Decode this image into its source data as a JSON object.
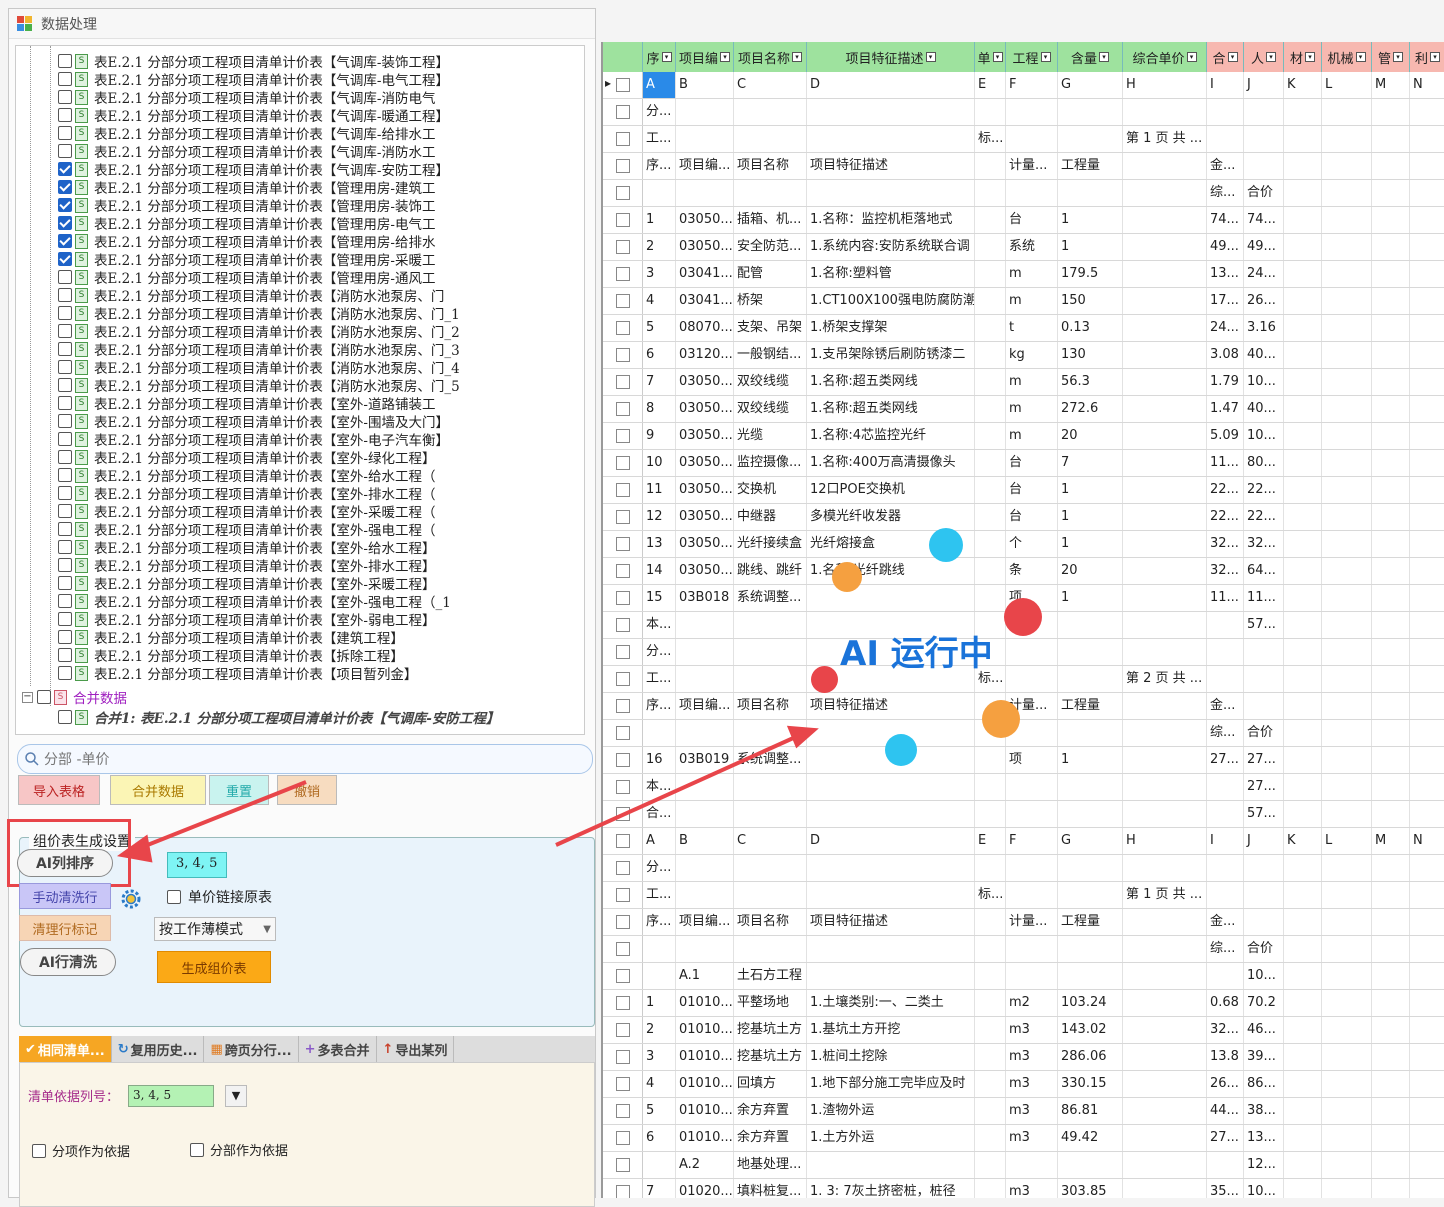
{
  "window": {
    "title": "数据处理"
  },
  "tree": {
    "items": [
      {
        "label": "表E.2.1 分部分项工程项目清单计价表【气调库-装饰工程】",
        "checked": false
      },
      {
        "label": "表E.2.1 分部分项工程项目清单计价表【气调库-电气工程】",
        "checked": false
      },
      {
        "label": "表E.2.1 分部分项工程项目清单计价表【气调库-消防电气",
        "checked": false
      },
      {
        "label": "表E.2.1 分部分项工程项目清单计价表【气调库-暖通工程】",
        "checked": false
      },
      {
        "label": "表E.2.1 分部分项工程项目清单计价表【气调库-给排水工",
        "checked": false
      },
      {
        "label": "表E.2.1 分部分项工程项目清单计价表【气调库-消防水工",
        "checked": false
      },
      {
        "label": "表E.2.1 分部分项工程项目清单计价表【气调库-安防工程】",
        "checked": true
      },
      {
        "label": "表E.2.1 分部分项工程项目清单计价表【管理用房-建筑工",
        "checked": true
      },
      {
        "label": "表E.2.1 分部分项工程项目清单计价表【管理用房-装饰工",
        "checked": true
      },
      {
        "label": "表E.2.1 分部分项工程项目清单计价表【管理用房-电气工",
        "checked": true
      },
      {
        "label": "表E.2.1 分部分项工程项目清单计价表【管理用房-给排水",
        "checked": true
      },
      {
        "label": "表E.2.1 分部分项工程项目清单计价表【管理用房-采暖工",
        "checked": true
      },
      {
        "label": "表E.2.1 分部分项工程项目清单计价表【管理用房-通风工",
        "checked": false
      },
      {
        "label": "表E.2.1 分部分项工程项目清单计价表【消防水池泵房、门",
        "checked": false
      },
      {
        "label": "表E.2.1 分部分项工程项目清单计价表【消防水池泵房、门_1",
        "checked": false
      },
      {
        "label": "表E.2.1 分部分项工程项目清单计价表【消防水池泵房、门_2",
        "checked": false
      },
      {
        "label": "表E.2.1 分部分项工程项目清单计价表【消防水池泵房、门_3",
        "checked": false
      },
      {
        "label": "表E.2.1 分部分项工程项目清单计价表【消防水池泵房、门_4",
        "checked": false
      },
      {
        "label": "表E.2.1 分部分项工程项目清单计价表【消防水池泵房、门_5",
        "checked": false
      },
      {
        "label": "表E.2.1 分部分项工程项目清单计价表【室外-道路铺装工",
        "checked": false
      },
      {
        "label": "表E.2.1 分部分项工程项目清单计价表【室外-围墙及大门】",
        "checked": false
      },
      {
        "label": "表E.2.1 分部分项工程项目清单计价表【室外-电子汽车衡】",
        "checked": false
      },
      {
        "label": "表E.2.1 分部分项工程项目清单计价表【室外-绿化工程】",
        "checked": false
      },
      {
        "label": "表E.2.1 分部分项工程项目清单计价表【室外-给水工程（",
        "checked": false
      },
      {
        "label": "表E.2.1 分部分项工程项目清单计价表【室外-排水工程（",
        "checked": false
      },
      {
        "label": "表E.2.1 分部分项工程项目清单计价表【室外-采暖工程（",
        "checked": false
      },
      {
        "label": "表E.2.1 分部分项工程项目清单计价表【室外-强电工程（",
        "checked": false
      },
      {
        "label": "表E.2.1 分部分项工程项目清单计价表【室外-给水工程】",
        "checked": false
      },
      {
        "label": "表E.2.1 分部分项工程项目清单计价表【室外-排水工程】",
        "checked": false
      },
      {
        "label": "表E.2.1 分部分项工程项目清单计价表【室外-采暖工程】",
        "checked": false
      },
      {
        "label": "表E.2.1 分部分项工程项目清单计价表【室外-强电工程（_1",
        "checked": false
      },
      {
        "label": "表E.2.1 分部分项工程项目清单计价表【室外-弱电工程】",
        "checked": false
      },
      {
        "label": "表E.2.1 分部分项工程项目清单计价表【建筑工程】",
        "checked": false
      },
      {
        "label": "表E.2.1 分部分项工程项目清单计价表【拆除工程】",
        "checked": false
      },
      {
        "label": "表E.2.1 分部分项工程项目清单计价表【项目暂列金】",
        "checked": false
      }
    ],
    "merge_node": "合并数据",
    "merge_child": "合并1: 表E.2.1 分部分项工程项目清单计价表【气调库-安防工程】"
  },
  "search": {
    "value": "分部 -单价"
  },
  "buttons": {
    "import": "导入表格",
    "merge": "合并数据",
    "reset": "重置",
    "undo": "撤销"
  },
  "group": {
    "title": "组价表生成设置",
    "ai_sort": "AI列排序",
    "columns_value": "3, 4, 5",
    "manual_clean": "手动清洗行",
    "unit_price_link": "单价链接原表",
    "clean_marks": "清理行标记",
    "mode_select": "按工作薄模式",
    "ai_clean": "AI行清洗",
    "generate": "生成组价表"
  },
  "tabs": [
    {
      "label": "相同清单..."
    },
    {
      "label": "复用历史..."
    },
    {
      "label": "跨页分行..."
    },
    {
      "label": "多表合并"
    },
    {
      "label": "导出某列"
    }
  ],
  "panel": {
    "list_basis_label": "清单依据列号：",
    "list_basis_value": "3, 4, 5",
    "opt_item": "分项作为依据",
    "opt_part": "分部作为依据"
  },
  "sheet": {
    "headers": [
      "序",
      "项目编",
      "项目名称",
      "项目特征描述",
      "单",
      "工程",
      "含量",
      "综合单价",
      "合",
      "人",
      "材",
      "机械",
      "管",
      "利"
    ],
    "rows": [
      [
        "A",
        "B",
        "C",
        "D",
        "E",
        "F",
        "G",
        "H",
        "I",
        "J",
        "K",
        "L",
        "M",
        "N"
      ],
      [
        "分...",
        "",
        "",
        "",
        "",
        "",
        "",
        "",
        "",
        "",
        "",
        "",
        "",
        ""
      ],
      [
        "工...",
        "",
        "",
        "",
        "标...",
        "",
        "",
        "第 1 页  共 ...",
        "",
        "",
        "",
        "",
        "",
        ""
      ],
      [
        "序...",
        "项目编...",
        "项目名称",
        "项目特征描述",
        "",
        "计量...",
        "工程量",
        "",
        "金...",
        "",
        "",
        "",
        "",
        ""
      ],
      [
        "",
        "",
        "",
        "",
        "",
        "",
        "",
        "",
        "综...",
        "合价",
        "",
        "",
        "",
        ""
      ],
      [
        "1",
        "03050...",
        "插箱、机...",
        "1.名称：监控机柜落地式",
        "",
        "台",
        "1",
        "",
        "74...",
        "74...",
        "",
        "",
        "",
        ""
      ],
      [
        "2",
        "03050...",
        "安全防范...",
        "1.系统内容:安防系统联合调",
        "",
        "系统",
        "1",
        "",
        "49...",
        "49...",
        "",
        "",
        "",
        ""
      ],
      [
        "3",
        "03041...",
        "配管",
        "1.名称:塑料管",
        "",
        "m",
        "179.5",
        "",
        "13...",
        "24...",
        "",
        "",
        "",
        ""
      ],
      [
        "4",
        "03041...",
        "桥架",
        "1.CT100X100强电防腐防潮",
        "",
        "m",
        "150",
        "",
        "17...",
        "26...",
        "",
        "",
        "",
        ""
      ],
      [
        "5",
        "08070...",
        "支架、吊架",
        "1.桥架支撑架",
        "",
        "t",
        "0.13",
        "",
        "24...",
        "3.16",
        "",
        "",
        "",
        ""
      ],
      [
        "6",
        "03120...",
        "一般钢结...",
        "1.支吊架除锈后刷防锈漆二",
        "",
        "kg",
        "130",
        "",
        "3.08",
        "40...",
        "",
        "",
        "",
        ""
      ],
      [
        "7",
        "03050...",
        "双绞线缆",
        "1.名称:超五类网线",
        "",
        "m",
        "56.3",
        "",
        "1.79",
        "10...",
        "",
        "",
        "",
        ""
      ],
      [
        "8",
        "03050...",
        "双绞线缆",
        "1.名称:超五类网线",
        "",
        "m",
        "272.6",
        "",
        "1.47",
        "40...",
        "",
        "",
        "",
        ""
      ],
      [
        "9",
        "03050...",
        "光缆",
        "1.名称:4芯监控光纤",
        "",
        "m",
        "20",
        "",
        "5.09",
        "10...",
        "",
        "",
        "",
        ""
      ],
      [
        "10",
        "03050...",
        "监控摄像...",
        "1.名称:400万高清摄像头",
        "",
        "台",
        "7",
        "",
        "11...",
        "80...",
        "",
        "",
        "",
        ""
      ],
      [
        "11",
        "03050...",
        "交换机",
        "12口POE交换机",
        "",
        "台",
        "1",
        "",
        "22...",
        "22...",
        "",
        "",
        "",
        ""
      ],
      [
        "12",
        "03050...",
        "中继器",
        "多模光纤收发器",
        "",
        "台",
        "1",
        "",
        "22...",
        "22...",
        "",
        "",
        "",
        ""
      ],
      [
        "13",
        "03050...",
        "光纤接续盒",
        "光纤熔接盒",
        "",
        "个",
        "1",
        "",
        "32...",
        "32...",
        "",
        "",
        "",
        ""
      ],
      [
        "14",
        "03050...",
        "跳线、跳纤",
        "1.名称:光纤跳线",
        "",
        "条",
        "20",
        "",
        "32...",
        "64...",
        "",
        "",
        "",
        ""
      ],
      [
        "15",
        "03B018",
        "系统调整...",
        "",
        "",
        "项",
        "1",
        "",
        "11...",
        "11...",
        "",
        "",
        "",
        ""
      ],
      [
        "本...",
        "",
        "",
        "",
        "",
        "",
        "",
        "",
        "",
        "57...",
        "",
        "",
        "",
        ""
      ],
      [
        "分...",
        "",
        "",
        "",
        "",
        "",
        "",
        "",
        "",
        "",
        "",
        "",
        "",
        ""
      ],
      [
        "工...",
        "",
        "",
        "",
        "标...",
        "",
        "",
        "第 2 页  共 ...",
        "",
        "",
        "",
        "",
        "",
        ""
      ],
      [
        "序...",
        "项目编...",
        "项目名称",
        "项目特征描述",
        "",
        "计量...",
        "工程量",
        "",
        "金...",
        "",
        "",
        "",
        "",
        ""
      ],
      [
        "",
        "",
        "",
        "",
        "",
        "",
        "",
        "",
        "综...",
        "合价",
        "",
        "",
        "",
        ""
      ],
      [
        "16",
        "03B019",
        "系统调整...",
        "",
        "",
        "项",
        "1",
        "",
        "27...",
        "27...",
        "",
        "",
        "",
        ""
      ],
      [
        "本...",
        "",
        "",
        "",
        "",
        "",
        "",
        "",
        "",
        "27...",
        "",
        "",
        "",
        ""
      ],
      [
        "合...",
        "",
        "",
        "",
        "",
        "",
        "",
        "",
        "",
        "57...",
        "",
        "",
        "",
        ""
      ],
      [
        "A",
        "B",
        "C",
        "D",
        "E",
        "F",
        "G",
        "H",
        "I",
        "J",
        "K",
        "L",
        "M",
        "N"
      ],
      [
        "分...",
        "",
        "",
        "",
        "",
        "",
        "",
        "",
        "",
        "",
        "",
        "",
        "",
        ""
      ],
      [
        "工...",
        "",
        "",
        "",
        "标...",
        "",
        "",
        "第 1 页  共 ...",
        "",
        "",
        "",
        "",
        "",
        ""
      ],
      [
        "序...",
        "项目编...",
        "项目名称",
        "项目特征描述",
        "",
        "计量...",
        "工程量",
        "",
        "金...",
        "",
        "",
        "",
        "",
        ""
      ],
      [
        "",
        "",
        "",
        "",
        "",
        "",
        "",
        "",
        "综...",
        "合价",
        "",
        "",
        "",
        ""
      ],
      [
        "",
        "A.1",
        "土石方工程",
        "",
        "",
        "",
        "",
        "",
        "",
        "10...",
        "",
        "",
        "",
        ""
      ],
      [
        "1",
        "01010...",
        "平整场地",
        "1.土壤类别:一、二类土",
        "",
        "m2",
        "103.24",
        "",
        "0.68",
        "70.2",
        "",
        "",
        "",
        ""
      ],
      [
        "2",
        "01010...",
        "挖基坑土方",
        "1.基坑土方开挖",
        "",
        "m3",
        "143.02",
        "",
        "32...",
        "46...",
        "",
        "",
        "",
        ""
      ],
      [
        "3",
        "01010...",
        "挖基坑土方",
        "1.桩间土挖除",
        "",
        "m3",
        "286.06",
        "",
        "13.8",
        "39...",
        "",
        "",
        "",
        ""
      ],
      [
        "4",
        "01010...",
        "回填方",
        "1.地下部分施工完毕应及时",
        "",
        "m3",
        "330.15",
        "",
        "26...",
        "86...",
        "",
        "",
        "",
        ""
      ],
      [
        "5",
        "01010...",
        "余方弃置",
        "1.渣物外运",
        "",
        "m3",
        "86.81",
        "",
        "44...",
        "38...",
        "",
        "",
        "",
        ""
      ],
      [
        "6",
        "01010...",
        "余方弃置",
        "1.土方外运",
        "",
        "m3",
        "49.42",
        "",
        "27...",
        "13...",
        "",
        "",
        "",
        ""
      ],
      [
        "",
        "A.2",
        "地基处理...",
        "",
        "",
        "",
        "",
        "",
        "",
        "12...",
        "",
        "",
        "",
        ""
      ],
      [
        "7",
        "01020...",
        "填料桩复...",
        "1. 3: 7灰土挤密桩，桩径",
        "",
        "m3",
        "303.85",
        "",
        "35...",
        "10...",
        "",
        "",
        "",
        ""
      ]
    ]
  },
  "overlay": {
    "text": "AI 运行中",
    "colors": {
      "blue": "#1a73d9",
      "cyan": "#2ec4f0",
      "orange": "#f5a040",
      "red": "#e8454a"
    }
  }
}
